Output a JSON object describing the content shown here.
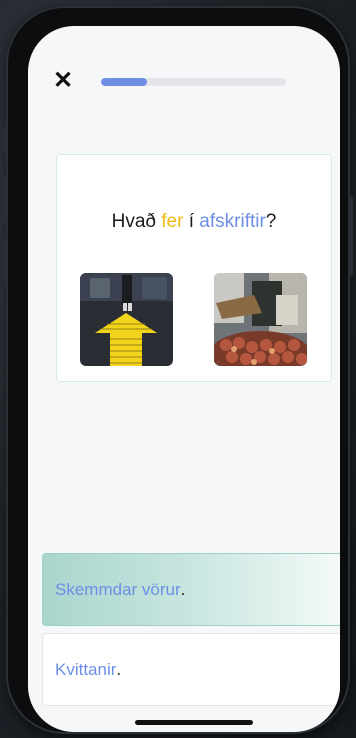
{
  "header": {
    "close_icon": "close-icon",
    "progress_fraction": 0.25
  },
  "question": {
    "prefix": "Hvað ",
    "word_yellow": "fer",
    "middle": " í ",
    "word_blue": "afskriftir",
    "suffix": "?"
  },
  "images": [
    {
      "name": "yellow-arrow-road-image"
    },
    {
      "name": "damaged-produce-image"
    }
  ],
  "options": [
    {
      "text": "Skemmdar vörur",
      "suffix": "."
    },
    {
      "text": "Kvittanir",
      "suffix": "."
    }
  ],
  "colors": {
    "accent_blue": "#6c8fe6",
    "accent_yellow": "#f0bb14",
    "selected_option": "#a9d5cd"
  }
}
